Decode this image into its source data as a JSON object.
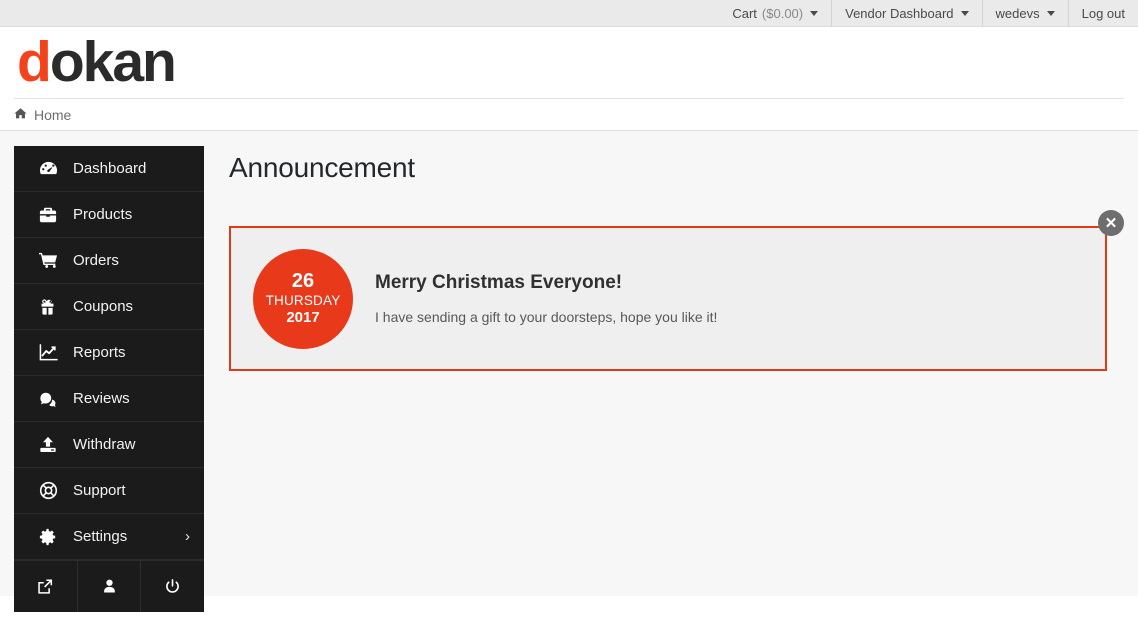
{
  "topbar": {
    "items": [
      {
        "label": "Cart",
        "value": "($0.00)",
        "caret": true,
        "name": "cart"
      },
      {
        "label": "Vendor Dashboard",
        "value": "",
        "caret": true,
        "name": "vendor-dashboard"
      },
      {
        "label": "wedevs",
        "value": "",
        "caret": true,
        "name": "account"
      },
      {
        "label": "Log out",
        "value": "",
        "caret": false,
        "name": "log-out"
      }
    ]
  },
  "logo": {
    "first": "d",
    "rest": "okan",
    "accent_color": "#f4421a"
  },
  "breadcrumb": {
    "home_label": "Home",
    "home_icon": "home-icon"
  },
  "sidebar": {
    "items": [
      {
        "label": "Dashboard",
        "icon": "dashboard-icon"
      },
      {
        "label": "Products",
        "icon": "briefcase-icon"
      },
      {
        "label": "Orders",
        "icon": "shopping-cart-icon"
      },
      {
        "label": "Coupons",
        "icon": "gift-icon"
      },
      {
        "label": "Reports",
        "icon": "chart-line-icon"
      },
      {
        "label": "Reviews",
        "icon": "comments-icon"
      },
      {
        "label": "Withdraw",
        "icon": "upload-icon"
      },
      {
        "label": "Support",
        "icon": "lifebuoy-icon"
      },
      {
        "label": "Settings",
        "icon": "gear-icon",
        "chevron": "›"
      }
    ],
    "footer_icons": [
      {
        "name": "external-link-icon"
      },
      {
        "name": "user-icon"
      },
      {
        "name": "power-icon"
      }
    ]
  },
  "main": {
    "page_title": "Announcement",
    "announcement": {
      "date": {
        "day": "26",
        "weekday": "THURSDAY",
        "year": "2017"
      },
      "title": "Merry Christmas Everyone!",
      "text": "I have sending a gift to your doorsteps, hope you like it!",
      "close_label": "✕",
      "border_color": "#dd3b17",
      "circle_color": "#e8391b"
    }
  }
}
